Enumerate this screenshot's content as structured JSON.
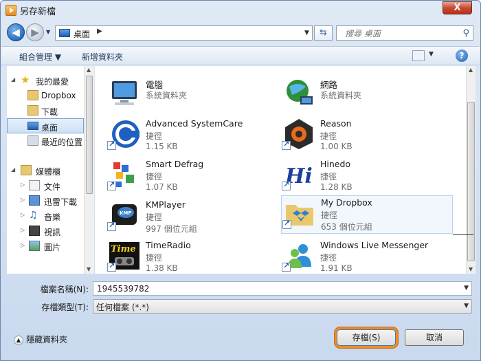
{
  "window": {
    "title": "另存新檔",
    "close_label": "X"
  },
  "nav": {
    "back_glyph": "◀",
    "forward_glyph": "▶",
    "address": {
      "location": "桌面",
      "separator": "▶"
    },
    "refresh_glyph": "⇆",
    "search_placeholder": "搜尋 桌面"
  },
  "toolbar": {
    "organize_label": "組合管理 ▼",
    "new_folder_label": "新增資料夾",
    "help_label": "?"
  },
  "sidebar": {
    "items": [
      {
        "label": "我的最愛",
        "icon": "star-icon"
      },
      {
        "label": "Dropbox",
        "icon": "dropbox-folder-icon"
      },
      {
        "label": "下載",
        "icon": "downloads-folder-icon"
      },
      {
        "label": "桌面",
        "icon": "desktop-icon"
      },
      {
        "label": "最近的位置",
        "icon": "recent-places-icon"
      },
      {
        "label": "媒體櫃",
        "icon": "libraries-icon"
      },
      {
        "label": "文件",
        "icon": "documents-icon"
      },
      {
        "label": "迅雷下載",
        "icon": "xunlei-icon"
      },
      {
        "label": "音樂",
        "icon": "music-icon"
      },
      {
        "label": "視訊",
        "icon": "video-icon"
      },
      {
        "label": "圖片",
        "icon": "pictures-icon"
      }
    ]
  },
  "files": [
    {
      "name": "電腦",
      "type": "系統資料夾",
      "size": "",
      "icon": "computer-icon"
    },
    {
      "name": "網路",
      "type": "系統資料夾",
      "size": "",
      "icon": "network-icon"
    },
    {
      "name": "Advanced SystemCare",
      "type": "捷徑",
      "size": "1.15 KB",
      "icon": "advanced-systemcare-icon"
    },
    {
      "name": "Reason",
      "type": "捷徑",
      "size": "1.00 KB",
      "icon": "reason-icon"
    },
    {
      "name": "Smart Defrag",
      "type": "捷徑",
      "size": "1.07 KB",
      "icon": "smart-defrag-icon"
    },
    {
      "name": "Hinedo",
      "type": "捷徑",
      "size": "1.28 KB",
      "icon": "hinedo-icon"
    },
    {
      "name": "KMPlayer",
      "type": "捷徑",
      "size": "997 個位元組",
      "icon": "kmplayer-icon"
    },
    {
      "name": "My Dropbox",
      "type": "捷徑",
      "size": "653 個位元組",
      "icon": "dropbox-icon"
    },
    {
      "name": "TimeRadio",
      "type": "捷徑",
      "size": "1.38 KB",
      "icon": "timeradio-icon"
    },
    {
      "name": "Windows Live Messenger",
      "type": "捷徑",
      "size": "1.91 KB",
      "icon": "messenger-icon"
    }
  ],
  "form": {
    "filename_label": "檔案名稱(N):",
    "filename_value": "1945539782",
    "filetype_label": "存檔類型(T):",
    "filetype_value": "任何檔案 (*.*)"
  },
  "footer": {
    "hide_folders_label": "隱藏資料夾",
    "save_label": "存檔(S)",
    "cancel_label": "取消"
  },
  "colors": {
    "accent": "#2a6ec0",
    "save_highlight": "#f08a2a",
    "close": "#c74a31"
  }
}
